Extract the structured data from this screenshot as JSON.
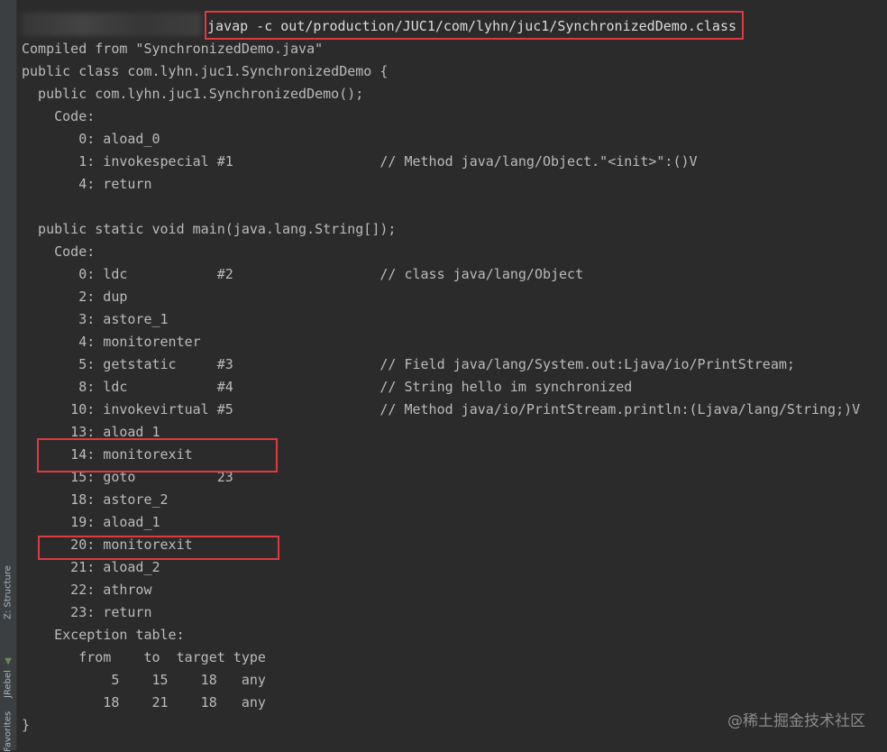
{
  "sidebar": {
    "tabs": [
      {
        "label": "Z: Structure",
        "icon": "structure-icon"
      },
      {
        "label": "JRebel",
        "icon": "jrebel-icon"
      },
      {
        "label": "Favorites",
        "icon": "favorites-icon"
      }
    ]
  },
  "terminal": {
    "command": "javap -c out/production/JUC1/com/lyhn/juc1/SynchronizedDemo.class",
    "lines": [
      "Compiled from \"SynchronizedDemo.java\"",
      "public class com.lyhn.juc1.SynchronizedDemo {",
      "  public com.lyhn.juc1.SynchronizedDemo();",
      "    Code:",
      "       0: aload_0",
      "       1: invokespecial #1                  // Method java/lang/Object.\"<init>\":()V",
      "       4: return",
      "",
      "  public static void main(java.lang.String[]);",
      "    Code:",
      "       0: ldc           #2                  // class java/lang/Object",
      "       2: dup",
      "       3: astore_1",
      "       4: monitorenter",
      "       5: getstatic     #3                  // Field java/lang/System.out:Ljava/io/PrintStream;",
      "       8: ldc           #4                  // String hello im synchronized",
      "      10: invokevirtual #5                  // Method java/io/PrintStream.println:(Ljava/lang/String;)V",
      "      13: aload_1",
      "      14: monitorexit",
      "      15: goto          23",
      "      18: astore_2",
      "      19: aload_1",
      "      20: monitorexit",
      "      21: aload_2",
      "      22: athrow",
      "      23: return",
      "    Exception table:",
      "       from    to  target type",
      "           5    15    18   any",
      "          18    21    18   any",
      "}"
    ]
  },
  "highlight_color": "#e0393e",
  "watermark": "@稀土掘金技术社区"
}
